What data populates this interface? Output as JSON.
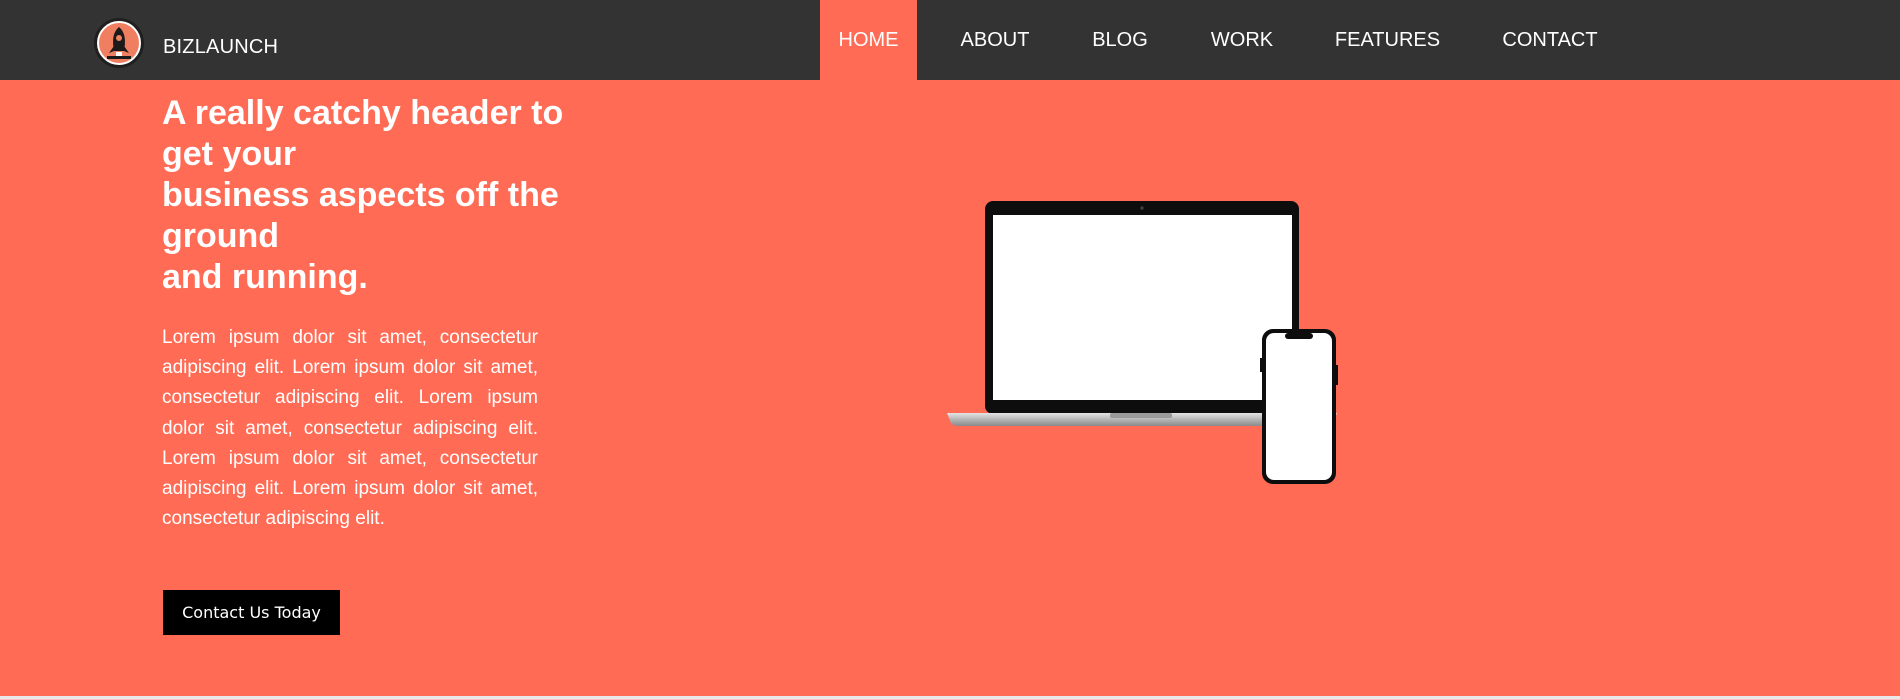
{
  "brand": {
    "name": "BIZLAUNCH",
    "logo_icon": "rocket-icon"
  },
  "nav": {
    "items": [
      {
        "label": "HOME",
        "active": true
      },
      {
        "label": "ABOUT",
        "active": false
      },
      {
        "label": "BLOG",
        "active": false
      },
      {
        "label": "WORK",
        "active": false
      },
      {
        "label": "FEATURES",
        "active": false
      },
      {
        "label": "CONTACT",
        "active": false
      }
    ]
  },
  "hero": {
    "headline_lines": [
      "A really catchy header to get your",
      "business aspects off the ground",
      "and running."
    ],
    "body": "Lorem ipsum dolor sit amet, consectetur adipiscing elit. Lorem ipsum dolor sit amet, consectetur adipiscing elit. Lorem ipsum dolor sit amet, consectetur adipiscing elit. Lorem ipsum dolor sit amet, consectetur adipiscing elit. Lorem ipsum dolor sit amet, consectetur adipiscing elit.",
    "cta_label": "Contact Us Today",
    "image_icon": "laptop-phone-mockup-icon"
  },
  "colors": {
    "navbar": "#333333",
    "accent": "#ff6b55",
    "text": "#ffffff",
    "button": "#000000"
  }
}
